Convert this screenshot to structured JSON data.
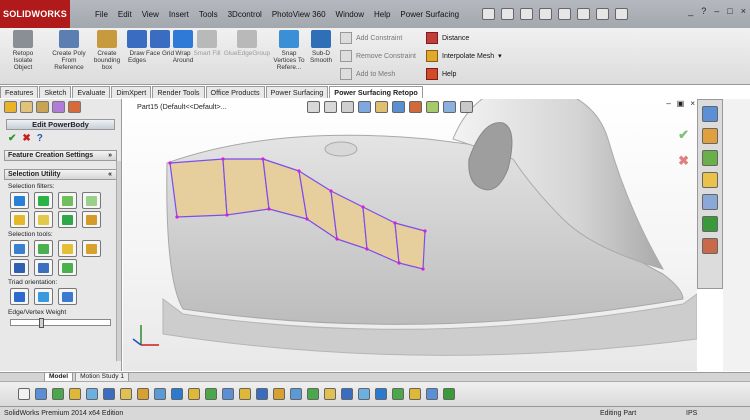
{
  "app": {
    "logo_text": "SOLIDWORKS",
    "menus": [
      "File",
      "Edit",
      "View",
      "Insert",
      "Tools",
      "3Dcontrol",
      "PhotoView 360",
      "Window",
      "Help",
      "Power Surfacing"
    ],
    "window_controls": [
      "_",
      "?",
      "–",
      "□",
      "×"
    ]
  },
  "ribbon": {
    "buttons": [
      {
        "label": "Retopo Isolate Object",
        "icon": "isolate-icon",
        "color": "#8a8f96"
      },
      {
        "label": "Create Poly From Reference",
        "icon": "poly-icon",
        "color": "#5a7fb0"
      },
      {
        "label": "Create bounding box",
        "icon": "box-icon",
        "color": "#c79a3e"
      },
      {
        "label": "Draw Edges",
        "icon": "draw-edges-icon",
        "color": "#3a6cc2"
      },
      {
        "label": "Face Grid",
        "icon": "face-grid-icon",
        "color": "#3a6cc2"
      },
      {
        "label": "Wrap Around",
        "icon": "wrap-icon",
        "color": "#2f7ad6"
      },
      {
        "label": "Smart Fill",
        "icon": "smart-fill-icon",
        "color": "#b9b9b9"
      },
      {
        "label": "GlueEdgeGroup",
        "icon": "glue-icon",
        "color": "#b9b9b9"
      },
      {
        "label": "Snap Vertices To Refere...",
        "icon": "snap-icon",
        "color": "#3a8fd6"
      },
      {
        "label": "Sub-D Smooth",
        "icon": "subd-icon",
        "color": "#2e6fb8"
      }
    ],
    "small_buttons": [
      {
        "label": "Add Constraint",
        "icon": "add-constraint-icon",
        "active": false
      },
      {
        "label": "Remove Constraint",
        "icon": "remove-constraint-icon",
        "active": false
      },
      {
        "label": "Add to Mesh",
        "icon": "add-mesh-icon",
        "active": false
      },
      {
        "label": "Distance",
        "icon": "distance-icon",
        "active": true
      },
      {
        "label": "Interpolate Mesh",
        "icon": "interpolate-icon",
        "active": true
      },
      {
        "label": "Help",
        "icon": "help-icon",
        "active": true
      }
    ]
  },
  "tabs": [
    {
      "label": "Features",
      "active": false
    },
    {
      "label": "Sketch",
      "active": false
    },
    {
      "label": "Evaluate",
      "active": false
    },
    {
      "label": "DimXpert",
      "active": false
    },
    {
      "label": "Render Tools",
      "active": false
    },
    {
      "label": "Office Products",
      "active": false
    },
    {
      "label": "Power Surfacing",
      "active": false
    },
    {
      "label": "Power Surfacing Retopo",
      "active": true
    }
  ],
  "panel": {
    "title": "Edit PowerBody",
    "accept_symbol": "✔",
    "cancel_symbol": "✖",
    "help_symbol": "?",
    "section_feature": "Feature Creation Settings",
    "section_feature_chevron": "»",
    "section_selection": "Selection Utility",
    "section_selection_chevron": "«",
    "selection_filters_label": "Selection filters:",
    "selection_tools_label": "Selection tools:",
    "triad_label": "Triad orientation:",
    "weight_label": "Edge/Vertex Weight",
    "weight_value": 0.3
  },
  "viewport": {
    "part_name": "Part15  (Default<<Default>..."
  },
  "model_tabs": [
    {
      "label": "Model",
      "active": true
    },
    {
      "label": "Motion Study 1",
      "active": false
    }
  ],
  "status": {
    "edition": "SolidWorks Premium 2014 x64 Edition",
    "mode": "Editing Part",
    "units": "IPS"
  },
  "colors": {
    "logo_red": "#b01a1a",
    "surface_grey": "#d6d6d6",
    "mesh_fill": "#e6cf9c",
    "mesh_edge": "#7a4df0",
    "vertex": "#d81fd8"
  }
}
